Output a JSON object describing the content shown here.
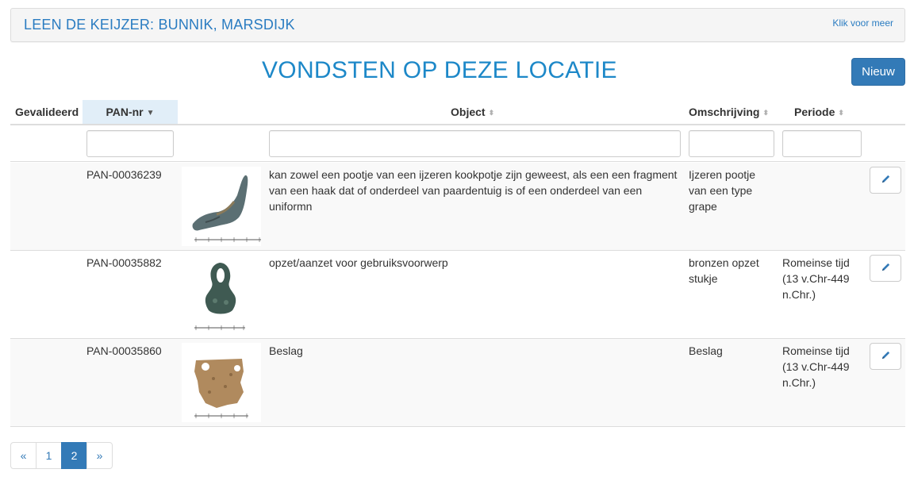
{
  "header": {
    "title": "LEEN DE KEIJZER: BUNNIK, MARSDIJK",
    "more_link": "Klik voor meer"
  },
  "main": {
    "title": "VONDSTEN OP DEZE LOCATIE",
    "new_button": "Nieuw"
  },
  "table": {
    "columns": {
      "validated": "Gevalideerd",
      "pan": "PAN-nr",
      "object": "Object",
      "description": "Omschrijving",
      "period": "Periode"
    },
    "sorted_column": "PAN-nr",
    "filters": {
      "pan": "",
      "object": "",
      "description": "",
      "period": ""
    },
    "rows": [
      {
        "pan": "PAN-00036239",
        "image": "photo of find with scale bar",
        "object": "kan zowel een pootje van een ijzeren kookpotje zijn geweest, als een een fragment van een haak dat of onderdeel van paardentuig is of een onderdeel van een uniformn",
        "description": "Ijzeren pootje van een type grape",
        "period": ""
      },
      {
        "pan": "PAN-00035882",
        "image": "photo of find with scale bar",
        "object": "opzet/aanzet voor gebruiksvoorwerp",
        "description": "bronzen opzet stukje",
        "period": "Romeinse tijd (13 v.Chr-449 n.Chr.)"
      },
      {
        "pan": "PAN-00035860",
        "image": "photo of find with scale bar",
        "object": "Beslag",
        "description": "Beslag",
        "period": "Romeinse tijd (13 v.Chr-449 n.Chr.)"
      }
    ]
  },
  "pagination": {
    "prev": "«",
    "pages": [
      "1",
      "2"
    ],
    "current": "2",
    "next": "»"
  },
  "colors": {
    "accent": "#337ab7",
    "title_blue": "#1d88c8",
    "sorted_header_bg": "#e1eef8",
    "striped_row_bg": "#f9f9f9"
  },
  "icons": {
    "edit": "pencil-icon",
    "sort": "sort-caret-icon"
  }
}
